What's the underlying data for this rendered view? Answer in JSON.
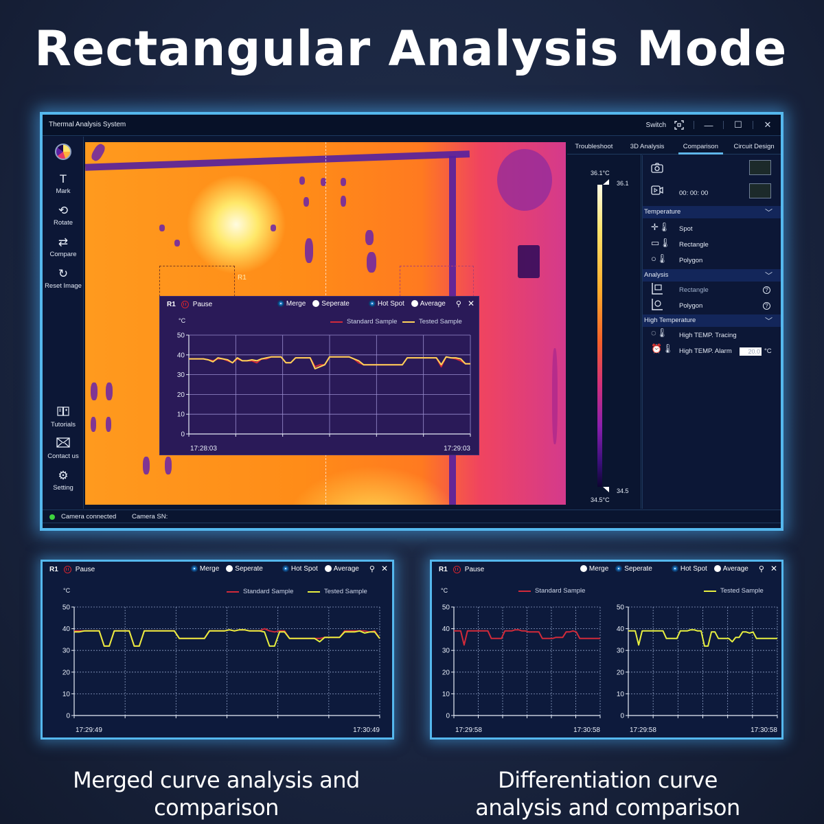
{
  "headline": "Rectangular Analysis Mode",
  "captions": {
    "left": "Merged curve analysis and comparison",
    "right": "Differentiation curve analysis and comparison"
  },
  "window": {
    "title": "Thermal Analysis System",
    "switch_label": "Switch",
    "controls": {
      "switch_icon": "switch-icon",
      "minimize": "—",
      "maximize": "☐",
      "close": "✕"
    }
  },
  "sidebar": {
    "top_icon": "color-palette-icon",
    "items": [
      {
        "label": "Mark",
        "icon": "T"
      },
      {
        "label": "Rotate",
        "icon": "⟲"
      },
      {
        "label": "Compare",
        "icon": "⇄"
      },
      {
        "label": "Reset Image",
        "icon": "↻"
      }
    ],
    "bottom_items": [
      {
        "label": "Tutorials",
        "icon": "📖"
      },
      {
        "label": "Contact us",
        "icon": "✉"
      },
      {
        "label": "Setting",
        "icon": "⚙"
      }
    ]
  },
  "image": {
    "roi_label": "R1"
  },
  "colorbar": {
    "max_label": "36.1°C",
    "max_marker": "36.1",
    "min_label": "34.5°C",
    "min_marker": "34.5"
  },
  "tabs": [
    {
      "label": "Troubleshoot",
      "active": false
    },
    {
      "label": "3D Analysis",
      "active": false
    },
    {
      "label": "Comparison",
      "active": true
    },
    {
      "label": "Circuit Design",
      "active": false
    }
  ],
  "capture": {
    "timer": "00: 00: 00"
  },
  "temperature_section": {
    "title": "Temperature",
    "items": [
      {
        "label": "Spot"
      },
      {
        "label": "Rectangle"
      },
      {
        "label": "Polygon"
      }
    ]
  },
  "analysis_section": {
    "title": "Analysis",
    "items": [
      {
        "label": "Rectangle",
        "help": "?"
      },
      {
        "label": "Polygon",
        "help": "?"
      }
    ]
  },
  "high_temp_section": {
    "title": "High Temperature",
    "tracing_label": "High TEMP. Tracing",
    "alarm_label": "High TEMP. Alarm",
    "alarm_value": "20.0",
    "alarm_unit": "°C"
  },
  "status": {
    "connection": "Camera connected",
    "sn_label": "Camera SN:"
  },
  "panel_common": {
    "roi": "R1",
    "pause": "Pause",
    "merge": "Merge",
    "separate": "Seperate",
    "hotspot": "Hot Spot",
    "average": "Average",
    "unit": "°C",
    "legend_standard": "Standard Sample",
    "legend_tested": "Tested Sample",
    "colors": {
      "standard": "#d22a3a",
      "tested_overlay": "#ffd45a",
      "tested": "#e8f040"
    }
  },
  "chart_data": [
    {
      "id": "overlay",
      "type": "line",
      "title": "",
      "ylabel": "°C",
      "ylim": [
        0,
        50
      ],
      "yticks": [
        0,
        10,
        20,
        30,
        40,
        50
      ],
      "xticks": [
        "17:28:03",
        "17:29:03"
      ],
      "mode": "Merge",
      "series": [
        {
          "name": "Standard Sample",
          "values": [
            38,
            38,
            38,
            38,
            37.5,
            37,
            38,
            38,
            37,
            36,
            38,
            37,
            37,
            37,
            36,
            38,
            38,
            39,
            39,
            39,
            36,
            36,
            38.5,
            38.5,
            38.5,
            38.5,
            34,
            35,
            35,
            39,
            39,
            39,
            39,
            39,
            38,
            36,
            35,
            35,
            35,
            35,
            35,
            35,
            35,
            35,
            35,
            38.5,
            38.5,
            38.5,
            38.5,
            38.5,
            38.5,
            38.5,
            34,
            39,
            38.5,
            38,
            37,
            35.5,
            35.5
          ]
        },
        {
          "name": "Tested Sample",
          "values": [
            38,
            38,
            38,
            38,
            37.5,
            36.5,
            38.5,
            38,
            37.5,
            36,
            38.5,
            37,
            37,
            37.5,
            37,
            38,
            38.5,
            39,
            39,
            39,
            36,
            36,
            38.5,
            38.5,
            38.5,
            38.5,
            33,
            34,
            35,
            39,
            39,
            39,
            39,
            39,
            38,
            37,
            35,
            35,
            35,
            35,
            35,
            35,
            35,
            35,
            35,
            38.5,
            38.5,
            38.5,
            38.5,
            38.5,
            38.5,
            38.5,
            35,
            39,
            38.5,
            38.5,
            38,
            35.5,
            35.5
          ]
        }
      ]
    },
    {
      "id": "merged",
      "type": "line",
      "ylabel": "°C",
      "ylim": [
        0,
        50
      ],
      "yticks": [
        0,
        10,
        20,
        30,
        40,
        50
      ],
      "xticks": [
        "17:29:49",
        "17:30:49"
      ],
      "mode": "Merge",
      "series": [
        {
          "name": "Standard Sample",
          "values": [
            39,
            39,
            39,
            39,
            39,
            39,
            32,
            32,
            39,
            39,
            39,
            39,
            32,
            32,
            39,
            39,
            39,
            39,
            39,
            39,
            39,
            35.5,
            35.5,
            35.5,
            35.5,
            35.5,
            35.5,
            39,
            39,
            39,
            39,
            39.5,
            39,
            39.5,
            39.5,
            39,
            39,
            39,
            40,
            39,
            38.5,
            39,
            39,
            35.5,
            35.5,
            35.5,
            35.5,
            35.5,
            35.5,
            35.5,
            36,
            36,
            36,
            36,
            39,
            39,
            39,
            39,
            39,
            38.5,
            39,
            35.5
          ]
        },
        {
          "name": "Tested Sample",
          "values": [
            38.5,
            38.5,
            39,
            39,
            39,
            39,
            32,
            32,
            39,
            39,
            39,
            39,
            32,
            32,
            39,
            39,
            39,
            39,
            39,
            39,
            39,
            35.5,
            35.5,
            35.5,
            35.5,
            35.5,
            35.5,
            39,
            39,
            39,
            39,
            39.5,
            39,
            39.5,
            39.5,
            39,
            39,
            39,
            38.5,
            32,
            32,
            38.5,
            38.5,
            35.5,
            35.5,
            35.5,
            35.5,
            35.5,
            35.5,
            34,
            36,
            36,
            36,
            36,
            38.5,
            38.5,
            38.5,
            39,
            38,
            38.5,
            38.5,
            35.5
          ]
        }
      ]
    },
    {
      "id": "separate-standard",
      "type": "line",
      "ylabel": "°C",
      "ylim": [
        0,
        50
      ],
      "yticks": [
        0,
        10,
        20,
        30,
        40,
        50
      ],
      "xticks": [
        "17:29:58",
        "17:30:58"
      ],
      "mode": "Seperate",
      "series": [
        {
          "name": "Standard Sample",
          "values": [
            39,
            39,
            39,
            32.5,
            39,
            39,
            39,
            39,
            39,
            39,
            39,
            35.5,
            35.5,
            35.5,
            35.5,
            39,
            39,
            39,
            39.5,
            39.5,
            39,
            39,
            38.5,
            38.5,
            38.5,
            38.5,
            35.5,
            35.5,
            35.5,
            35.5,
            36,
            36,
            36,
            38.5,
            38.5,
            39,
            38.5,
            35.5,
            35.5,
            35.5,
            35.5,
            35.5,
            35.5,
            35.5
          ]
        }
      ]
    },
    {
      "id": "separate-tested",
      "type": "line",
      "ylabel": "°C",
      "ylim": [
        0,
        50
      ],
      "yticks": [
        0,
        10,
        20,
        30,
        40,
        50
      ],
      "xticks": [
        "17:29:58",
        "17:30:58"
      ],
      "mode": "Seperate",
      "series": [
        {
          "name": "Tested Sample",
          "values": [
            39,
            39,
            39,
            32.5,
            39,
            39,
            39,
            39,
            39,
            39,
            39,
            35.5,
            35.5,
            35.5,
            35.5,
            39,
            39,
            39,
            39.5,
            39.5,
            39,
            39,
            32,
            32,
            38.5,
            38.5,
            35.5,
            35.5,
            35.5,
            35.5,
            34,
            36,
            36,
            38.5,
            38.5,
            38,
            38.5,
            35.5,
            35.5,
            35.5,
            35.5,
            35.5,
            35.5,
            35.5
          ]
        }
      ]
    }
  ]
}
